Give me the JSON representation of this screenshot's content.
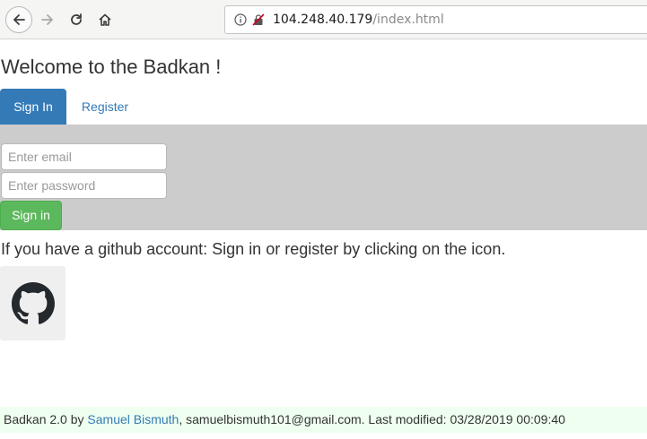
{
  "browser": {
    "url_host": "104.248.40.179",
    "url_path": "/index.html",
    "icons": [
      "back-arrow-icon",
      "forward-arrow-icon",
      "reload-icon",
      "home-icon",
      "info-icon",
      "insecure-lock-icon"
    ]
  },
  "page": {
    "title": "Welcome to the Badkan !",
    "tabs": [
      {
        "label": "Sign In",
        "active": true
      },
      {
        "label": "Register",
        "active": false
      }
    ],
    "form": {
      "email_placeholder": "Enter email",
      "password_placeholder": "Enter password",
      "submit_label": "Sign in"
    },
    "github_note": "If you have a github account: Sign in or register by clicking on the icon.",
    "github_icon": "github-icon"
  },
  "footer": {
    "prefix": "Badkan 2.0 by ",
    "author": "Samuel Bismuth",
    "suffix": ", samuelbismuth101@gmail.com. Last modified: 03/28/2019 00:09:40"
  },
  "colors": {
    "primary": "#337ab7",
    "success": "#5cb85c",
    "panel_bg": "#cccccc",
    "footer_bg": "#effff0"
  }
}
